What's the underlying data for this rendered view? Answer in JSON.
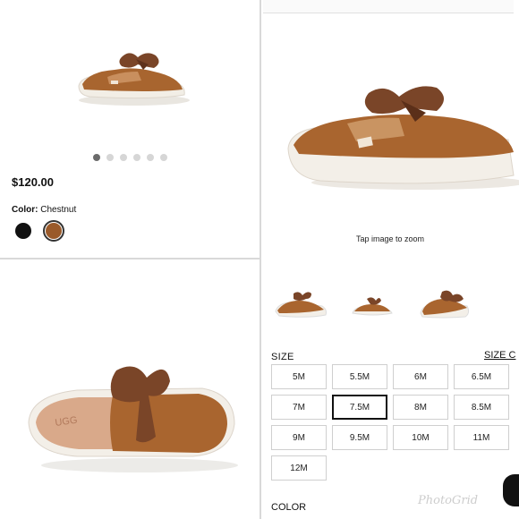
{
  "product": {
    "price": "$120.00",
    "color_label": "Color:",
    "color_value": "Chestnut",
    "swatches": [
      {
        "name": "Black",
        "hex": "#111111",
        "selected": false
      },
      {
        "name": "Chestnut",
        "hex": "#9a5a2a",
        "selected": true
      }
    ],
    "carousel": {
      "count": 6,
      "active": 1
    }
  },
  "zoom": {
    "hint": "Tap image to zoom"
  },
  "sizes": {
    "heading": "SIZE",
    "chart_link": "SIZE C",
    "options": [
      "5M",
      "5.5M",
      "6M",
      "6.5M",
      "7M",
      "7.5M",
      "8M",
      "8.5M",
      "9M",
      "9.5M",
      "10M",
      "11M",
      "12M"
    ],
    "selected": "7.5M"
  },
  "color_section": {
    "heading": "COLOR"
  },
  "watermark": "PhotoGrid",
  "colors": {
    "chestnut": "#9a5a2a",
    "bow": "#7a4528",
    "sole": "#f1ece4"
  }
}
